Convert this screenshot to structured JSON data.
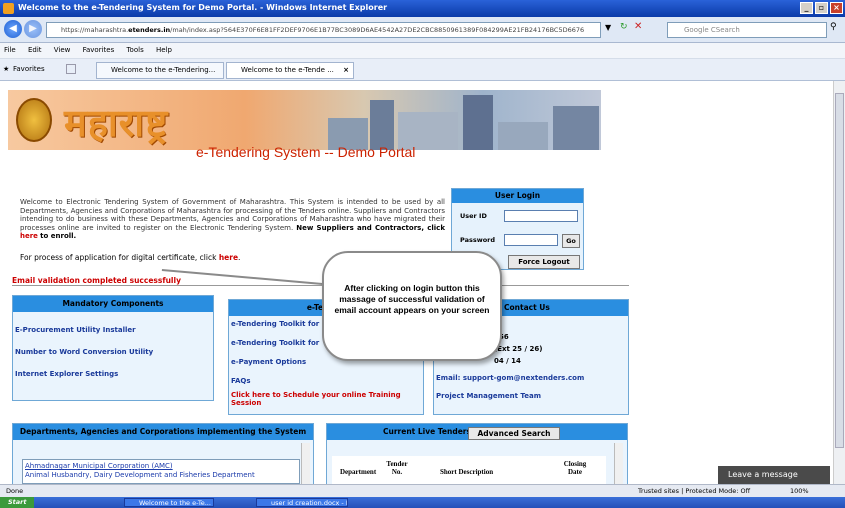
{
  "window": {
    "title": "Welcome to the e-Tendering System for Demo Portal. - Windows Internet Explorer"
  },
  "address": {
    "url_prefix": "https://maharashtra.",
    "url_domain": "etenders.in",
    "url_rest": "/mah/index.asp?564E370F6E81FF2DEF9706E1B77BC3089D6AE4542A27DE2CBC8850961389F084299AE21FB24176BC5D6676",
    "search_placeholder": "Google CSearch"
  },
  "menu": [
    "File",
    "Edit",
    "View",
    "Favorites",
    "Tools",
    "Help"
  ],
  "favbar": {
    "favorites": "Favorites",
    "tab1": "Welcome to the e-Tendering...",
    "tab2": "Welcome to the e-Tende ..."
  },
  "banner": {
    "brand": "महाराष्ट्र"
  },
  "portal_title": "e-Tendering System -- Demo Portal",
  "welcome": {
    "text": "Welcome to Electronic Tendering System of Government of Maharashtra. This System is intended to be used by all Departments, Agencies and Corporations of Maharashtra for processing of the Tenders online. Suppliers and Contractors intending to do business with these Departments, Agencies and Corporations of Maharashtra who have migrated their processes online are invited to register on the Electronic Tendering System.",
    "new_users": "New Suppliers and Contractors, click",
    "here": "here",
    "enroll": "to enroll."
  },
  "cert": {
    "text": "For process of application for digital certificate, click",
    "here": "here",
    "dot": "."
  },
  "login": {
    "heading": "User Login",
    "user_id": "User ID",
    "password": "Password",
    "go": "Go",
    "force_logout": "Force Logout"
  },
  "email_msg": "Email validation completed successfully",
  "mandatory": {
    "heading": "Mandatory Components",
    "items": [
      "E-Procurement Utility Installer",
      "Number to Word Conversion Utility",
      "Internet Explorer Settings"
    ]
  },
  "etender": {
    "heading": "e-Tenderi",
    "items": [
      "e-Tendering Toolkit for",
      "e-Tendering Toolkit for",
      "e-Payment Options",
      "FAQs"
    ],
    "training": "Click here to Schedule your online Training Session"
  },
  "contact": {
    "heading": "Contact Us",
    "line1": "/ 56",
    "line2": "(Ext 25 / 26)",
    "line3": "04 / 14",
    "email": "Email: support-gom@nextenders.com",
    "team": "Project Management Team"
  },
  "callout": "After clicking on login button this massage of successful validation of email account appears on your screen",
  "departments": {
    "heading": "Departments, Agencies and Corporations implementing the System",
    "items": [
      "Ahmadnagar Municipal Corporation (AMC)",
      "Animal Husbandry, Dairy Development and Fisheries Department"
    ]
  },
  "tenders": {
    "heading": "Current Live Tenders",
    "advanced": "Advanced Search",
    "columns": [
      "Department",
      "Tender No.",
      "Short Description",
      "Closing Date"
    ]
  },
  "chat": "Leave a message",
  "status": {
    "done": "Done",
    "zone": "Trusted sites | Protected Mode: Off",
    "zoom": "100%"
  },
  "taskbar": {
    "start": "Start",
    "item1": "Welcome to the e-Te...",
    "item2": "user id creation.docx - M..."
  }
}
